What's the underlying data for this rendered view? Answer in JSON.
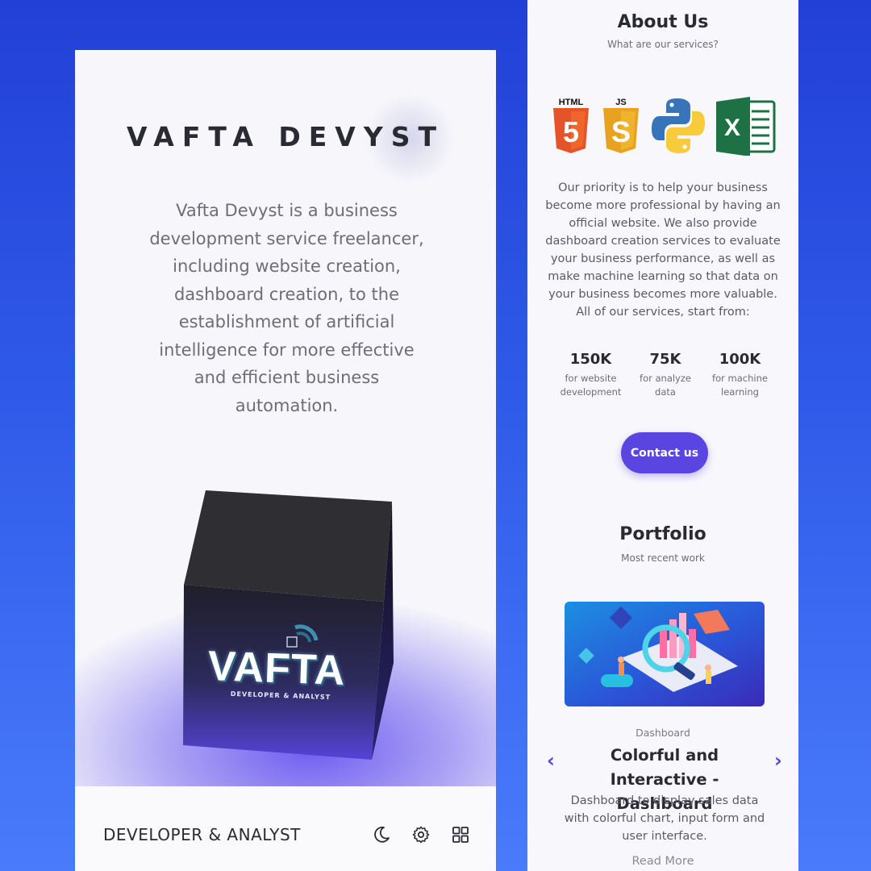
{
  "left_screen": {
    "brand": "VAFTA DEVYST",
    "intro": "Vafta Devyst is a business development service freelancer, including website creation, dashboard creation, to the establishment of artificial intelligence for more effective and efficient business automation.",
    "cube": {
      "logo_text": "VAFTA",
      "logo_subtitle": "DEVELOPER & ANALYST"
    },
    "bottom_bar": {
      "title": "DEVELOPER & ANALYST",
      "icons": [
        "moon-icon",
        "gear-icon",
        "grid-icon"
      ]
    }
  },
  "right_screen": {
    "about": {
      "title": "About Us",
      "subtitle": "What are our services?",
      "logos": {
        "html_label": "HTML",
        "js_label": "JS",
        "html_number": "5",
        "js_letter": "S",
        "excel_letter": "X"
      },
      "text": "Our priority is to help your business become more professional by having an official website. We also provide dashboard creation services to evaluate your business performance, as well as make machine learning so that data on your business becomes more valuable. All of our services, start from:"
    },
    "prices": [
      {
        "value": "150K",
        "label": "for website development"
      },
      {
        "value": "75K",
        "label": "for analyze data"
      },
      {
        "value": "100K",
        "label": "for machine learning"
      }
    ],
    "contact_button": "Contact us",
    "portfolio": {
      "title": "Portfolio",
      "subtitle": "Most recent work",
      "category": "Dashboard",
      "item_title": "Colorful and Interactive - Dashboard",
      "item_desc": "Dashboard to display sales data with colorful chart, input form and user interface.",
      "read_more": "Read More",
      "prev_arrow": "‹",
      "next_arrow": "›"
    }
  },
  "colors": {
    "background": "#2f5ae9",
    "accent": "#5b45e0",
    "cube_top": "#2d2d32",
    "html_orange": "#e4532a",
    "js_yellow": "#f0b32e",
    "python_blue": "#3874b8",
    "python_yellow": "#f8cb3c",
    "excel_green": "#1e7145"
  }
}
